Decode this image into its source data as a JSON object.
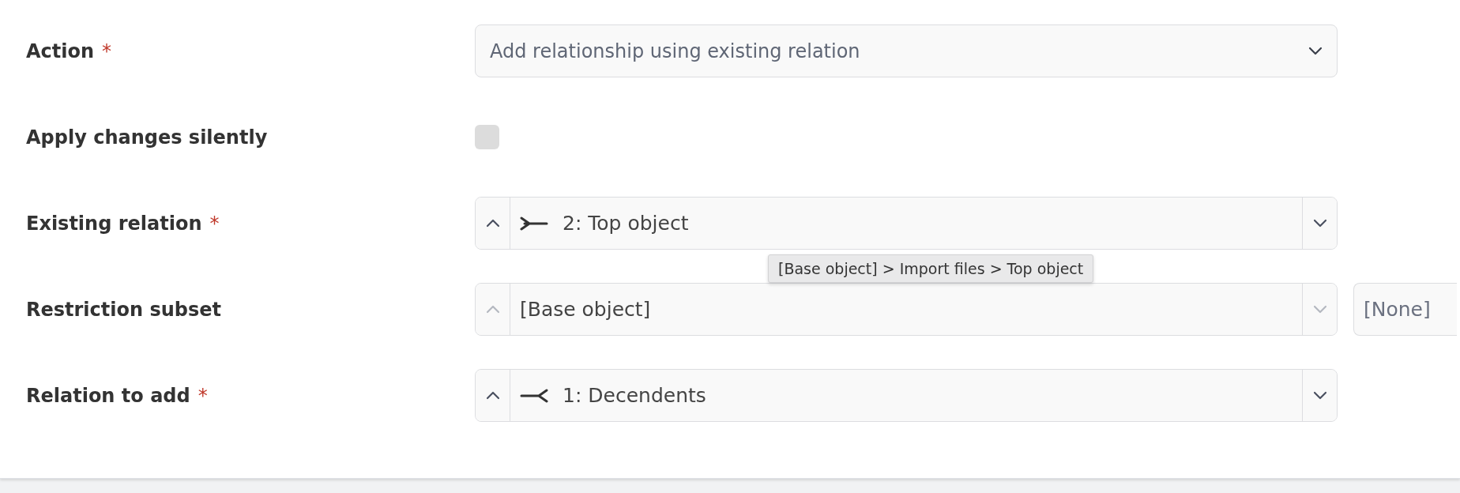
{
  "required_mark": "*",
  "fields": [
    {
      "kind": "select",
      "label": "Action",
      "required": true,
      "value": "Add relationship using existing relation"
    },
    {
      "kind": "checkbox",
      "label": "Apply changes silently",
      "required": false,
      "checked": false
    },
    {
      "kind": "merge_stepper",
      "label": "Existing relation",
      "required": true,
      "value": "2: Top object",
      "arrows_enabled": true
    },
    {
      "kind": "stepper",
      "label": "Restriction subset",
      "required": false,
      "value": "[Base object]",
      "arrows_enabled": false,
      "secondary_value": "[None]"
    },
    {
      "kind": "split_stepper",
      "label": "Relation to add",
      "required": true,
      "value": "1: Decendents",
      "arrows_enabled": true
    }
  ],
  "tooltip": "[Base object] > Import files > Top object"
}
